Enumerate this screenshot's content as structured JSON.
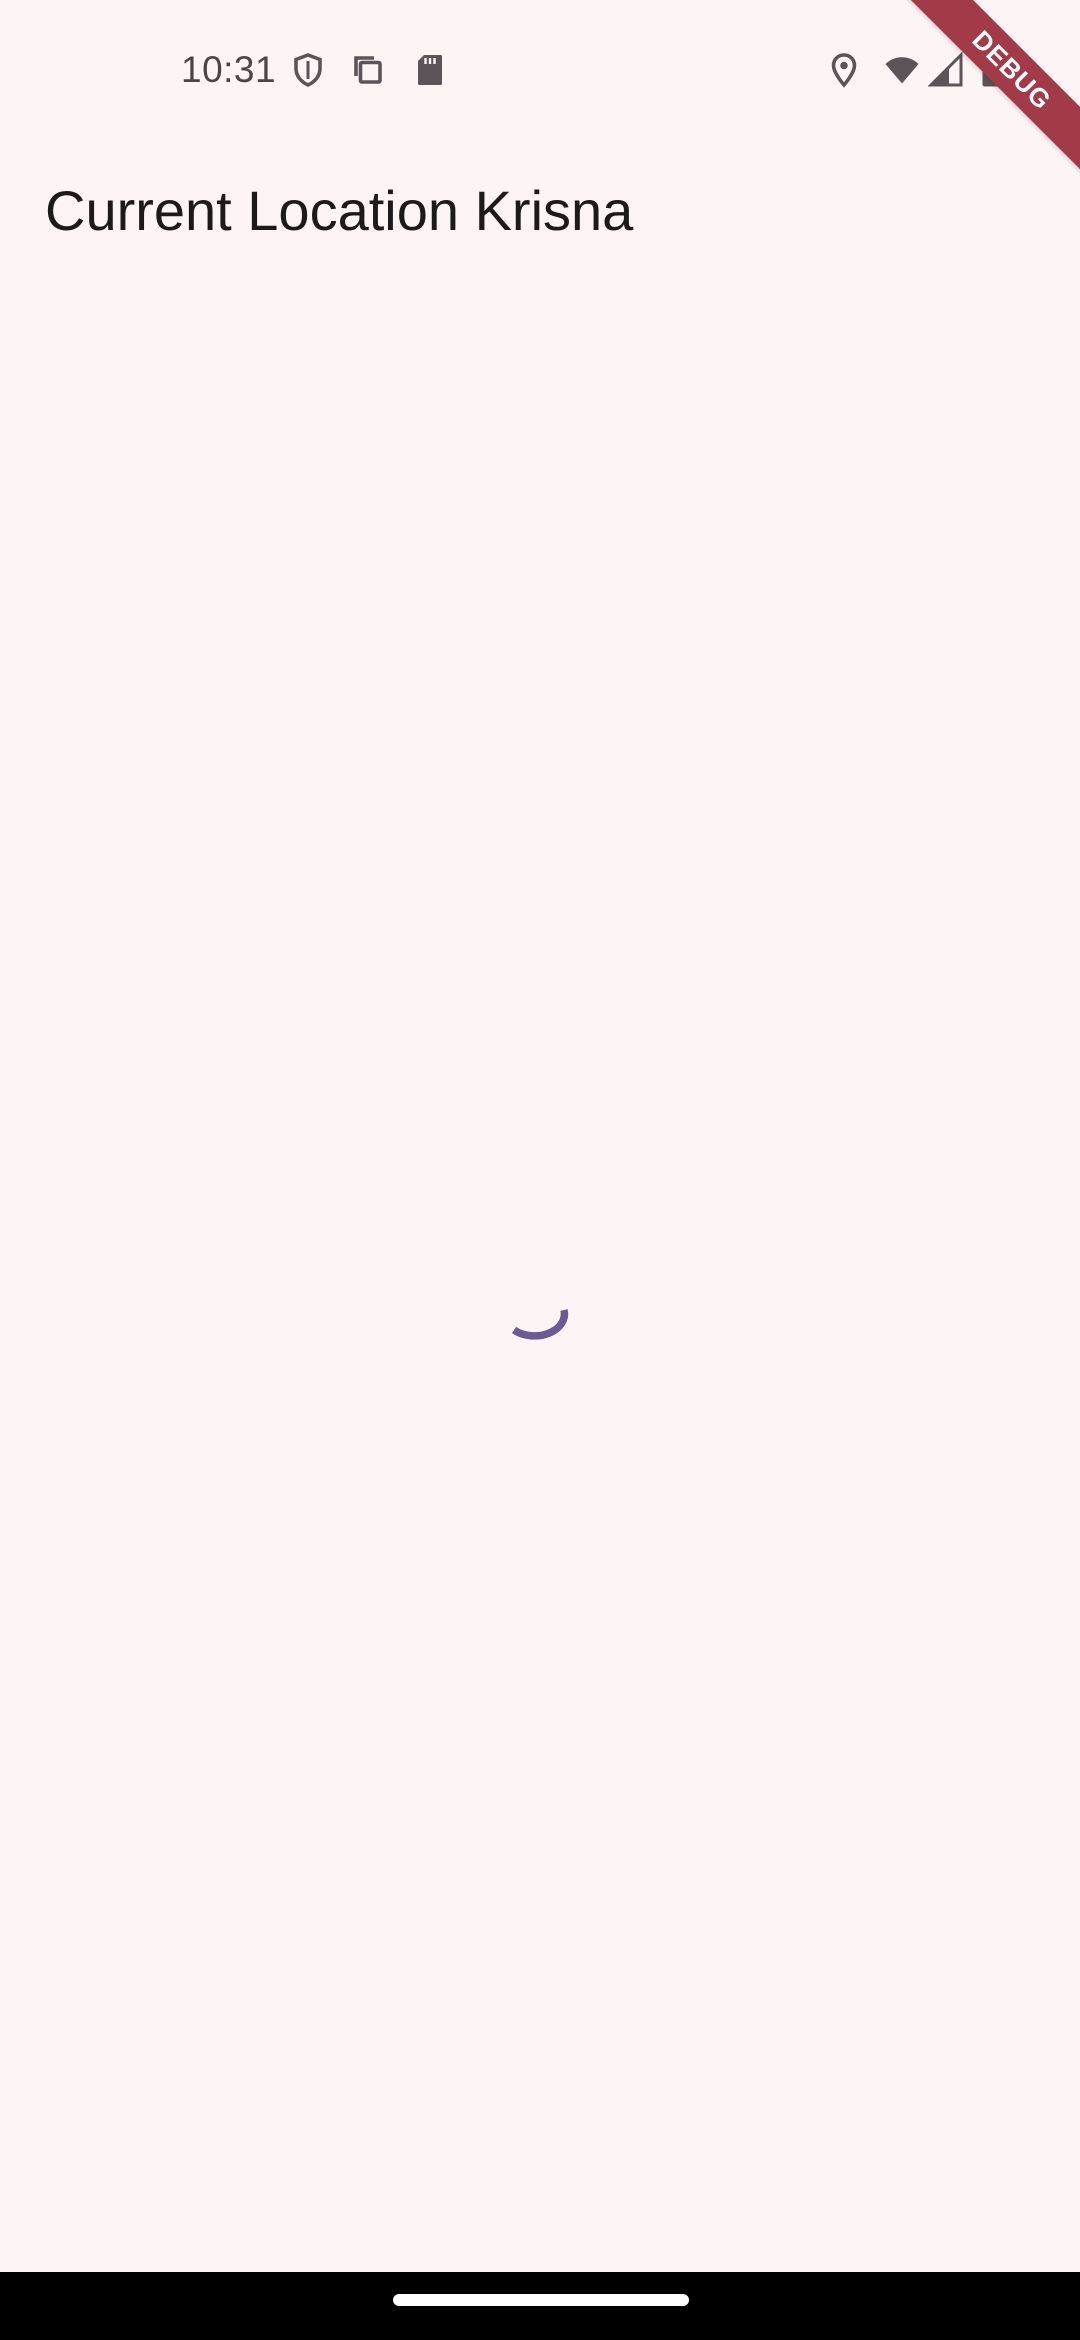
{
  "status_bar": {
    "time": "10:31",
    "left_icons": [
      "shield-icon",
      "copy-icon",
      "sd-card-icon"
    ],
    "right_icons": [
      "location-icon",
      "wifi-icon",
      "signal-icon",
      "battery-icon"
    ],
    "icon_color": "#5c5458"
  },
  "app_bar": {
    "title": "Current Location Krisna"
  },
  "content": {
    "loading_indicator": "circular-progress-indicator",
    "spinner_color": "#6b5b95"
  },
  "debug_banner": {
    "label": "DEBUG",
    "color": "#a23a47"
  },
  "theme": {
    "background": "#fcf4f5",
    "navigation_bar": "#000000"
  }
}
